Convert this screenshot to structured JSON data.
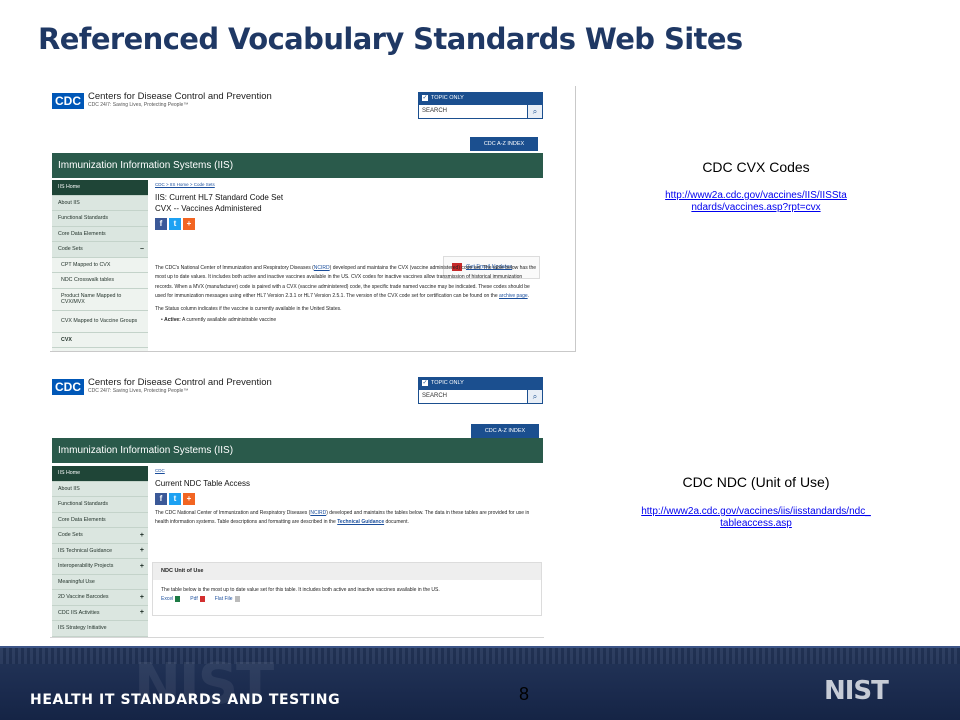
{
  "title": "Referenced Vocabulary Standards Web Sites",
  "cdc": {
    "logo": "CDC",
    "org": "Centers for Disease Control and Prevention",
    "tagline": "CDC 24/7: Saving Lives, Protecting People™",
    "topic_only": "TOPIC ONLY",
    "search_placeholder": "SEARCH",
    "az_index": "CDC A-Z INDEX",
    "iis_title": "Immunization Information Systems (IIS)"
  },
  "shot1": {
    "nav": [
      {
        "label": "IIS Home",
        "state": "active"
      },
      {
        "label": "About IIS"
      },
      {
        "label": "Functional Standards"
      },
      {
        "label": "Core Data Elements"
      },
      {
        "label": "Code Sets",
        "mark": "−"
      },
      {
        "label": "CPT Mapped to CVX",
        "state": "sub"
      },
      {
        "label": "NDC Crosswalk tables",
        "state": "sub"
      },
      {
        "label": "Product Name Mapped to CVX/MVX",
        "state": "sub-tall"
      },
      {
        "label": "CVX Mapped to Vaccine Groups",
        "state": "sub-tall"
      },
      {
        "label": "CVX",
        "state": "sub-bold"
      }
    ],
    "breadcrumb": "CDC  >  IIS Home  >  Code Sets",
    "heading1": "IIS: Current HL7 Standard Code Set",
    "heading2": "CVX -- Vaccines Administered",
    "email_updates": "Get Email Updates",
    "para_pre": "The CDC's National Center of Immunization and Respiratory Diseases (",
    "para_link": "NCIRD",
    "para_post": ") developed and maintains the CVX (vaccine administered) code set. The table below has the most up to date values. It includes both active and inactive vaccines available in the US. CVX codes for inactive vaccines allow transmission of historical immunization records. When a MVX (manufacturer) code is paired with a CVX (vaccine administered) code, the specific trade named vaccine may be indicated. These codes should be used for immunization messages using either HL7 Version 2.3.1 or HL7 Version 2.5.1. The version of the CVX code set for certification can be found on the ",
    "archive_link": "archive page",
    "para_end": ".",
    "status_line": "The Status column indicates if the vaccine is currently available in the United States.",
    "bullet_label": "Active:",
    "bullet_text": "A currently available administrable vaccine"
  },
  "shot2": {
    "nav": [
      {
        "label": "IIS Home",
        "state": "active"
      },
      {
        "label": "About IIS"
      },
      {
        "label": "Functional Standards"
      },
      {
        "label": "Core Data Elements"
      },
      {
        "label": "Code Sets",
        "mark": "+"
      },
      {
        "label": "IIS Technical Guidance",
        "mark": "+"
      },
      {
        "label": "Interoperability Projects",
        "mark": "+"
      },
      {
        "label": "Meaningful Use"
      },
      {
        "label": "2D Vaccine Barcodes",
        "mark": "+"
      },
      {
        "label": "CDC IIS Activities",
        "mark": "+"
      },
      {
        "label": "IIS Strategy Initiative"
      }
    ],
    "breadcrumb": "CDC",
    "heading": "Current NDC Table Access",
    "para_pre": "The CDC National Center of Immunization and Respiratory Diseases (",
    "para_link": "NCIRD",
    "para_mid": ") developed and maintains the tables below. The data in these tables are provided for use in health information systems. Table descriptions and formatting are described in the ",
    "guidance_link": "Technical Guidance",
    "para_end": " document.",
    "panel_title": "NDC Unit of Use",
    "panel_text": "The table below is the most up to date value set for this table. It includes both active and inactive vaccines available in the US.",
    "excel": "Excel",
    "pdf": "Pdf",
    "flat": "Flat File"
  },
  "captions": {
    "cvx_title": "CDC CVX Codes",
    "cvx_url_1": "http://www2a.cdc.gov/vaccines/IIS/IISSta",
    "cvx_url_2": "ndards/vaccines.asp?rpt=cvx",
    "ndc_title": "CDC NDC (Unit of Use)",
    "ndc_url_1": "http://www2a.cdc.gov/vaccines/iis/iisstandards/ndc_",
    "ndc_url_2": "tableaccess.asp"
  },
  "footer": {
    "program": "HEALTH IT STANDARDS AND TESTING",
    "page_number": "8",
    "logo": "NIST"
  }
}
